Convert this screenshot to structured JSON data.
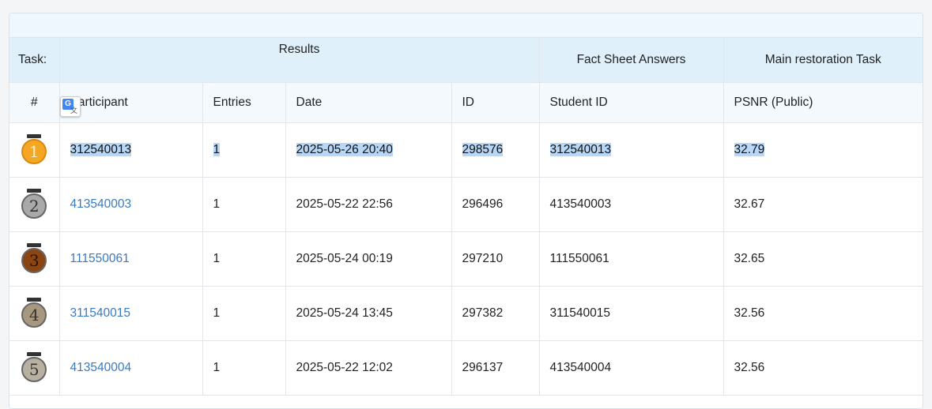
{
  "header": {
    "task_label": "Task:",
    "results_label": "Results",
    "fact_sheet_label": "Fact Sheet Answers",
    "main_task_label": "Main restoration Task"
  },
  "columns": {
    "rank": "#",
    "participant": "Participant",
    "entries": "Entries",
    "date": "Date",
    "id": "ID",
    "student_id": "Student ID",
    "psnr": "PSNR (Public)"
  },
  "rows": [
    {
      "rank": "1",
      "medal_color": "#f5a623",
      "participant": "312540013",
      "entries": "1",
      "date": "2025-05-26 20:40",
      "id": "298576",
      "student_id": "312540013",
      "psnr": "32.79",
      "selected": true
    },
    {
      "rank": "2",
      "medal_color": "#a9a9a9",
      "participant": "413540003",
      "entries": "1",
      "date": "2025-05-22 22:56",
      "id": "296496",
      "student_id": "413540003",
      "psnr": "32.67"
    },
    {
      "rank": "3",
      "medal_color": "#8b4513",
      "participant": "111550061",
      "entries": "1",
      "date": "2025-05-24 00:19",
      "id": "297210",
      "student_id": "111550061",
      "psnr": "32.65"
    },
    {
      "rank": "4",
      "medal_color": "#a89880",
      "participant": "311540015",
      "entries": "1",
      "date": "2025-05-24 13:45",
      "id": "297382",
      "student_id": "311540015",
      "psnr": "32.56"
    },
    {
      "rank": "5",
      "medal_color": "#b8b0a0",
      "participant": "413540004",
      "entries": "1",
      "date": "2025-05-22 12:02",
      "id": "296137",
      "student_id": "413540004",
      "psnr": "32.56"
    }
  ],
  "overlay": {
    "icon": "google-translate-icon",
    "badge_letter": "G"
  }
}
